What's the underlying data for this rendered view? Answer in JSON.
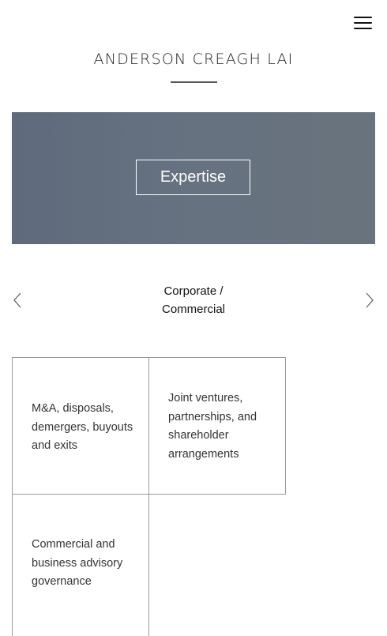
{
  "header": {
    "menu_icon": "hamburger-menu-icon",
    "logo_text": "ANDERSON CREAGH LAI"
  },
  "hero": {
    "button_label": "Expertise",
    "background_colors": [
      "#5f6b7c",
      "#69737e"
    ]
  },
  "carousel": {
    "title_line1": "Corporate /",
    "title_line2": "Commercial",
    "prev_icon": "chevron-left-icon",
    "next_icon": "chevron-right-icon"
  },
  "services": [
    {
      "label": "M&A, disposals, demergers, buyouts and exits"
    },
    {
      "label": "Joint ventures, partnerships, and shareholder arrangements"
    },
    {
      "label": "Commercial and business advisory governance"
    }
  ]
}
